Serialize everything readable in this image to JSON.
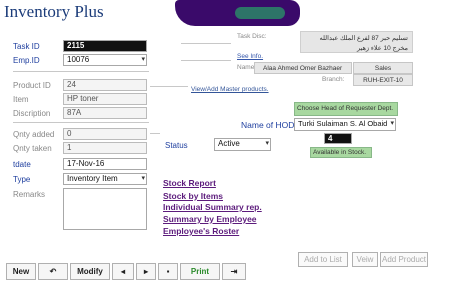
{
  "app": {
    "title": "Inventory Plus"
  },
  "form": {
    "task_id_label": "Task ID",
    "task_id": "2115",
    "emp_id_label": "Emp.ID",
    "emp_id": "10076",
    "product_id_label": "Product ID",
    "product_id": "24",
    "item_label": "Item",
    "item": "HP toner",
    "description_label": "Discription",
    "description": "87A",
    "qnty_added_label": "Qnty added",
    "qnty_added": "0",
    "qnty_taken_label": "Qnty taken",
    "qnty_taken": "1",
    "tdate_label": "tdate",
    "tdate": "17-Nov-16",
    "type_label": "Type",
    "type": "Inventory Item",
    "remarks_label": "Remarks",
    "remarks": ""
  },
  "task_info": {
    "task_disc_label": "Task Disc:",
    "task_disc": "تسليم حبر 87 لفرع الملك عبدالله مخرج 10 علاء زهير",
    "see_info": "See Info.",
    "name_label": "Name:",
    "name": "Alaa Ahmed Omer Bazhaer",
    "department": "Sales",
    "branch_label": "Branch:",
    "branch": "RUH-EXIT-10"
  },
  "view_add_master": "View/Add Master products.",
  "status": {
    "label": "Status",
    "value": "Active"
  },
  "hod": {
    "choose_hint": "Choose Head of Requester Dept.",
    "label": "Name of HOD:",
    "value": "Turki Sulaiman S. Al Obaid",
    "stock_count": "4",
    "available": "Available in Stock."
  },
  "reports": [
    "Stock Report",
    "Stock by Items",
    "Individual Summary rep.",
    "Summary by Employee",
    "Employee's Roster"
  ],
  "toolbar": {
    "new": "New",
    "undo_icon": "↶",
    "modify": "Modify",
    "prev": "◂",
    "next": "▸",
    "search_icon": "▪",
    "print": "Print",
    "exit_icon": "⇥",
    "add_to_list": "Add to List",
    "view": "Veiw",
    "add_product": "Add Product"
  },
  "colors": {
    "title": "#1c3c7a",
    "link": "#5c1b7c",
    "label_blue": "#1f3f9f",
    "highlight_green": "#a8d8a0"
  }
}
